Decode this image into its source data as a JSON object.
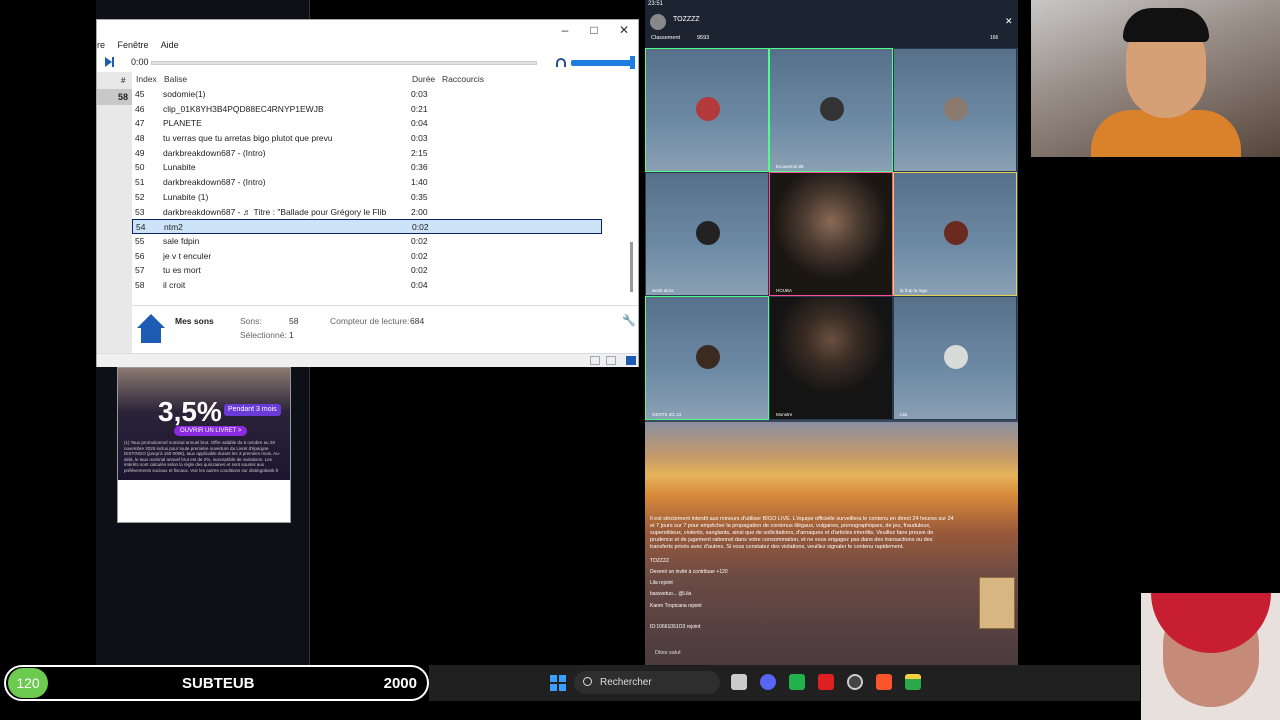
{
  "player": {
    "menu": [
      "re",
      "Fenêtre",
      "Aide"
    ],
    "time": "0:00",
    "columns": {
      "index": "Index",
      "tag": "Balise",
      "duration": "Durée",
      "shortcuts": "Raccourcis",
      "hash": "#"
    },
    "left_selected": "58",
    "rows": [
      {
        "idx": "45",
        "title": "sodomie(1)",
        "dur": "0:03"
      },
      {
        "idx": "46",
        "title": "clip_01K8YH3B4PQD88EC4RNYP1EWJB",
        "dur": "0:21"
      },
      {
        "idx": "47",
        "title": "PLANETE",
        "dur": "0:04"
      },
      {
        "idx": "48",
        "title": "tu verras que tu arretas bigo plutot que prevu",
        "dur": "0:03"
      },
      {
        "idx": "49",
        "title": "darkbreakdown687 - (Intro)",
        "dur": "2:15"
      },
      {
        "idx": "50",
        "title": "Lunabite",
        "dur": "0:36"
      },
      {
        "idx": "51",
        "title": "darkbreakdown687 - (Intro)",
        "dur": "1:40"
      },
      {
        "idx": "52",
        "title": "Lunabite (1)",
        "dur": "0:35"
      },
      {
        "idx": "53",
        "title": "darkbreakdown687 - ♬ Titre : \"Ballade pour Grégory le Flib",
        "dur": "2:00"
      },
      {
        "idx": "54",
        "title": "ntm2",
        "dur": "0:02"
      },
      {
        "idx": "55",
        "title": "sale fdpin",
        "dur": "0:02"
      },
      {
        "idx": "56",
        "title": "je v t enculer",
        "dur": "0:02"
      },
      {
        "idx": "57",
        "title": "tu es mort",
        "dur": "0:02"
      },
      {
        "idx": "58",
        "title": "il croit",
        "dur": "0:04"
      }
    ],
    "selected_row": 9,
    "footer": {
      "library": "Mes sons",
      "sounds_label": "Sons:",
      "sounds_value": "58",
      "selected_label": "Sélectionné:",
      "selected_value": "1",
      "counter_label": "Compteur de lecture:",
      "counter_value": "684"
    }
  },
  "ad": {
    "rate": "3,5%",
    "period": "Pendant 3 mois",
    "cta": "OUVRIR UN LIVRET >",
    "fine": "(1) Taux promotionnel nominal annuel brut. Offre valable du 6 octobre au 28 novembre 2025 inclus pour toute première ouverture du Livret d'épargne DISTINGO (jusqu'à 150 000€), taux applicable durant les 3 premiers mois. Au-delà, le taux nominal annuel brut est de 2%, susceptible de variations. Les intérêts sont calculés selon la règle des quinzaines et sont soumis aux prélèvements sociaux et fiscaux. Voir les autres conditions sur distingobank.fr"
  },
  "stream": {
    "clock": "23:51",
    "host": "TOZZZZ",
    "ranking": "Classement",
    "count": "9593",
    "viewers": "166",
    "users": [
      "",
      "Ecoutemoi 88",
      "",
      "wesh alors",
      "HOUBA",
      "la frop la rage",
      "GENTS 3G 13",
      "Monstre",
      "Lila"
    ],
    "notice": "Il est strictement interdit aux mineurs d'utiliser BIGO LIVE. L'équipe officielle surveillera le contenu en direct 24 heures sur 24 et 7 jours sur 7 pour empêcher la propagation de contenus illégaux, vulgaires, pornographiques, de jeu, frauduleux, superstitieux, violents, sanglants, ainsi que de sollicitations, d'arnaques et d'articles interdits. Veuillez faire preuve de prudence et de jugement rationnel dans votre consommation, et ne vous engagez pas dans des transactions ou des transferts privés avec d'autres. Si vous constatez des violations, veuillez signaler le contenu rapidement.",
    "chat": [
      "TOZZZZ",
      "Devenir un invité à contribuer +120",
      "Lila rejoint",
      "bassvetuo... @Lila",
      "Karen Tropicana rejoint",
      "ID:10661051O3 rejoint"
    ],
    "say": "Dites salut"
  },
  "subgoal": {
    "count": "120",
    "label": "SUBTEUB",
    "goal": "2000"
  },
  "taskbar": {
    "search": "Rechercher"
  }
}
